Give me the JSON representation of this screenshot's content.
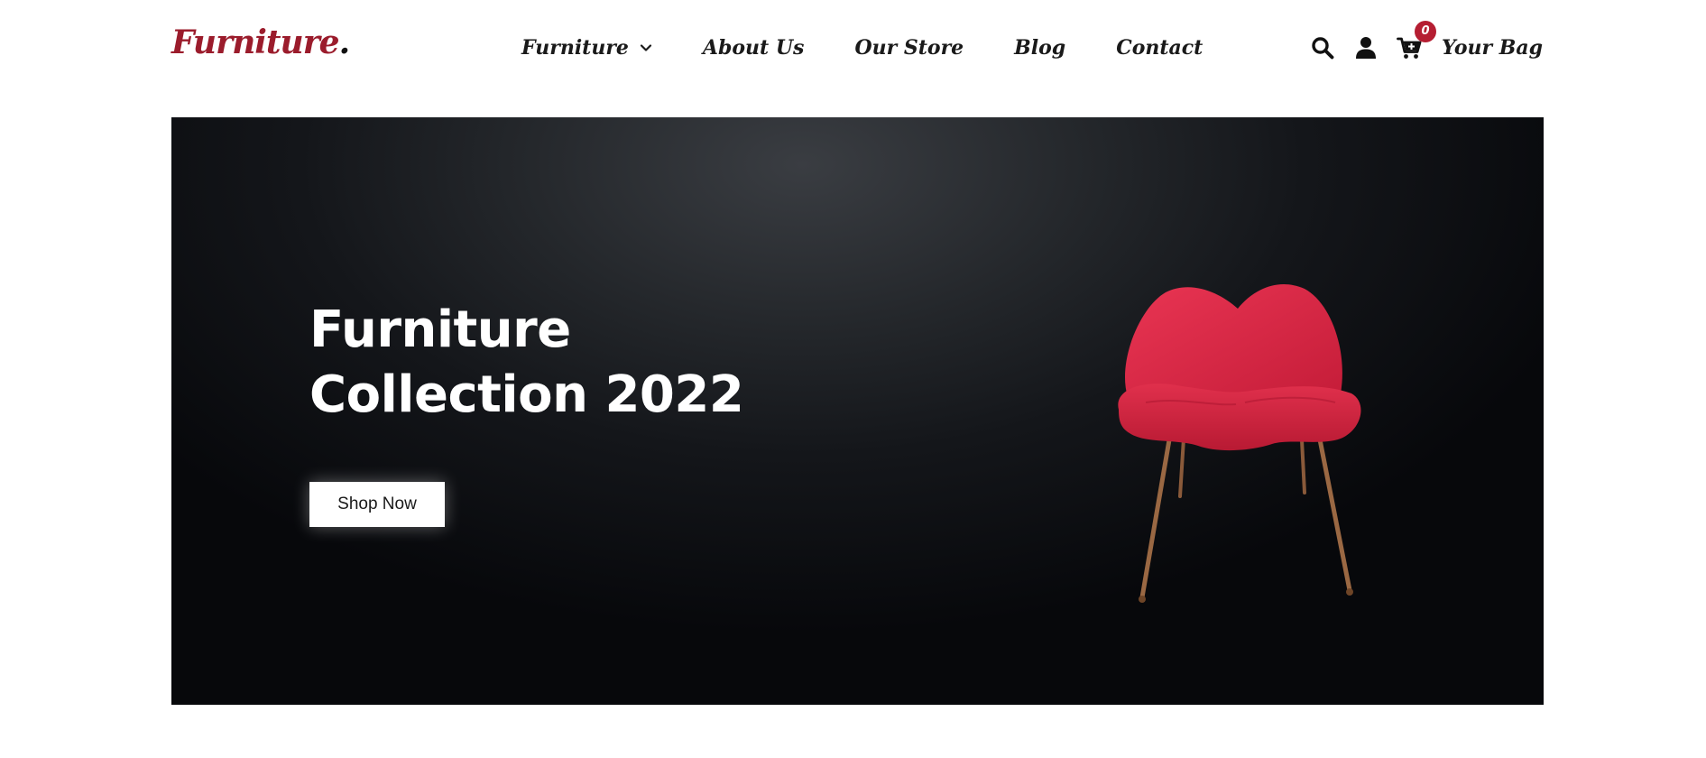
{
  "brand": {
    "name": "Furniture",
    "dot": "."
  },
  "nav": {
    "items": [
      {
        "label": "Furniture",
        "has_dropdown": true
      },
      {
        "label": "About Us"
      },
      {
        "label": "Our Store"
      },
      {
        "label": "Blog"
      },
      {
        "label": "Contact"
      }
    ]
  },
  "actions": {
    "search_icon": "search-icon",
    "user_icon": "user-icon",
    "cart_icon": "cart-icon",
    "cart_count": "0",
    "bag_label": "Your Bag"
  },
  "hero": {
    "title_line1": "Furniture",
    "title_line2": "Collection 2022",
    "cta_label": "Shop Now",
    "image": "red-chair"
  },
  "colors": {
    "brand": "#9b1c2c",
    "badge": "#b51e32",
    "hero_bg": "#0b0c0f",
    "chair": "#d8243f"
  }
}
